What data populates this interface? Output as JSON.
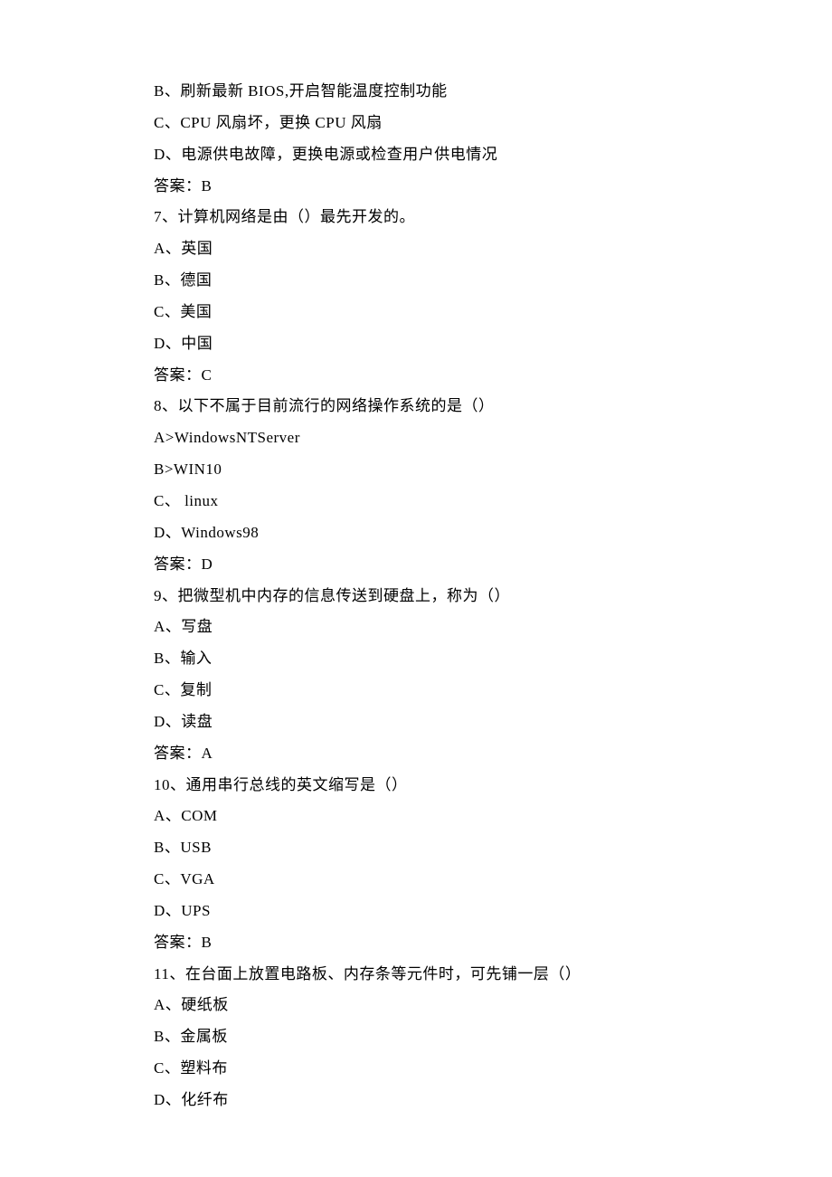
{
  "lines": [
    "B、刷新最新 BIOS,开启智能温度控制功能",
    "C、CPU 风扇坏，更换 CPU 风扇",
    "D、电源供电故障，更换电源或检查用户供电情况",
    "答案：B",
    "7、计算机网络是由（）最先开发的。",
    "A、英国",
    "B、德国",
    "C、美国",
    "D、中国",
    "答案：C",
    "8、以下不属于目前流行的网络操作系统的是（）",
    "A>WindowsNTServer",
    "B>WIN10",
    "C、 linux",
    "D、Windows98",
    "答案：D",
    "9、把微型机中内存的信息传送到硬盘上，称为（）",
    "A、写盘",
    "B、输入",
    "C、复制",
    "D、读盘",
    "答案：A",
    "10、通用串行总线的英文缩写是（）",
    "A、COM",
    "B、USB",
    "C、VGA",
    "D、UPS",
    "答案：B",
    "11、在台面上放置电路板、内存条等元件时，可先铺一层（）",
    "A、硬纸板",
    "B、金属板",
    "C、塑料布",
    "D、化纤布"
  ]
}
